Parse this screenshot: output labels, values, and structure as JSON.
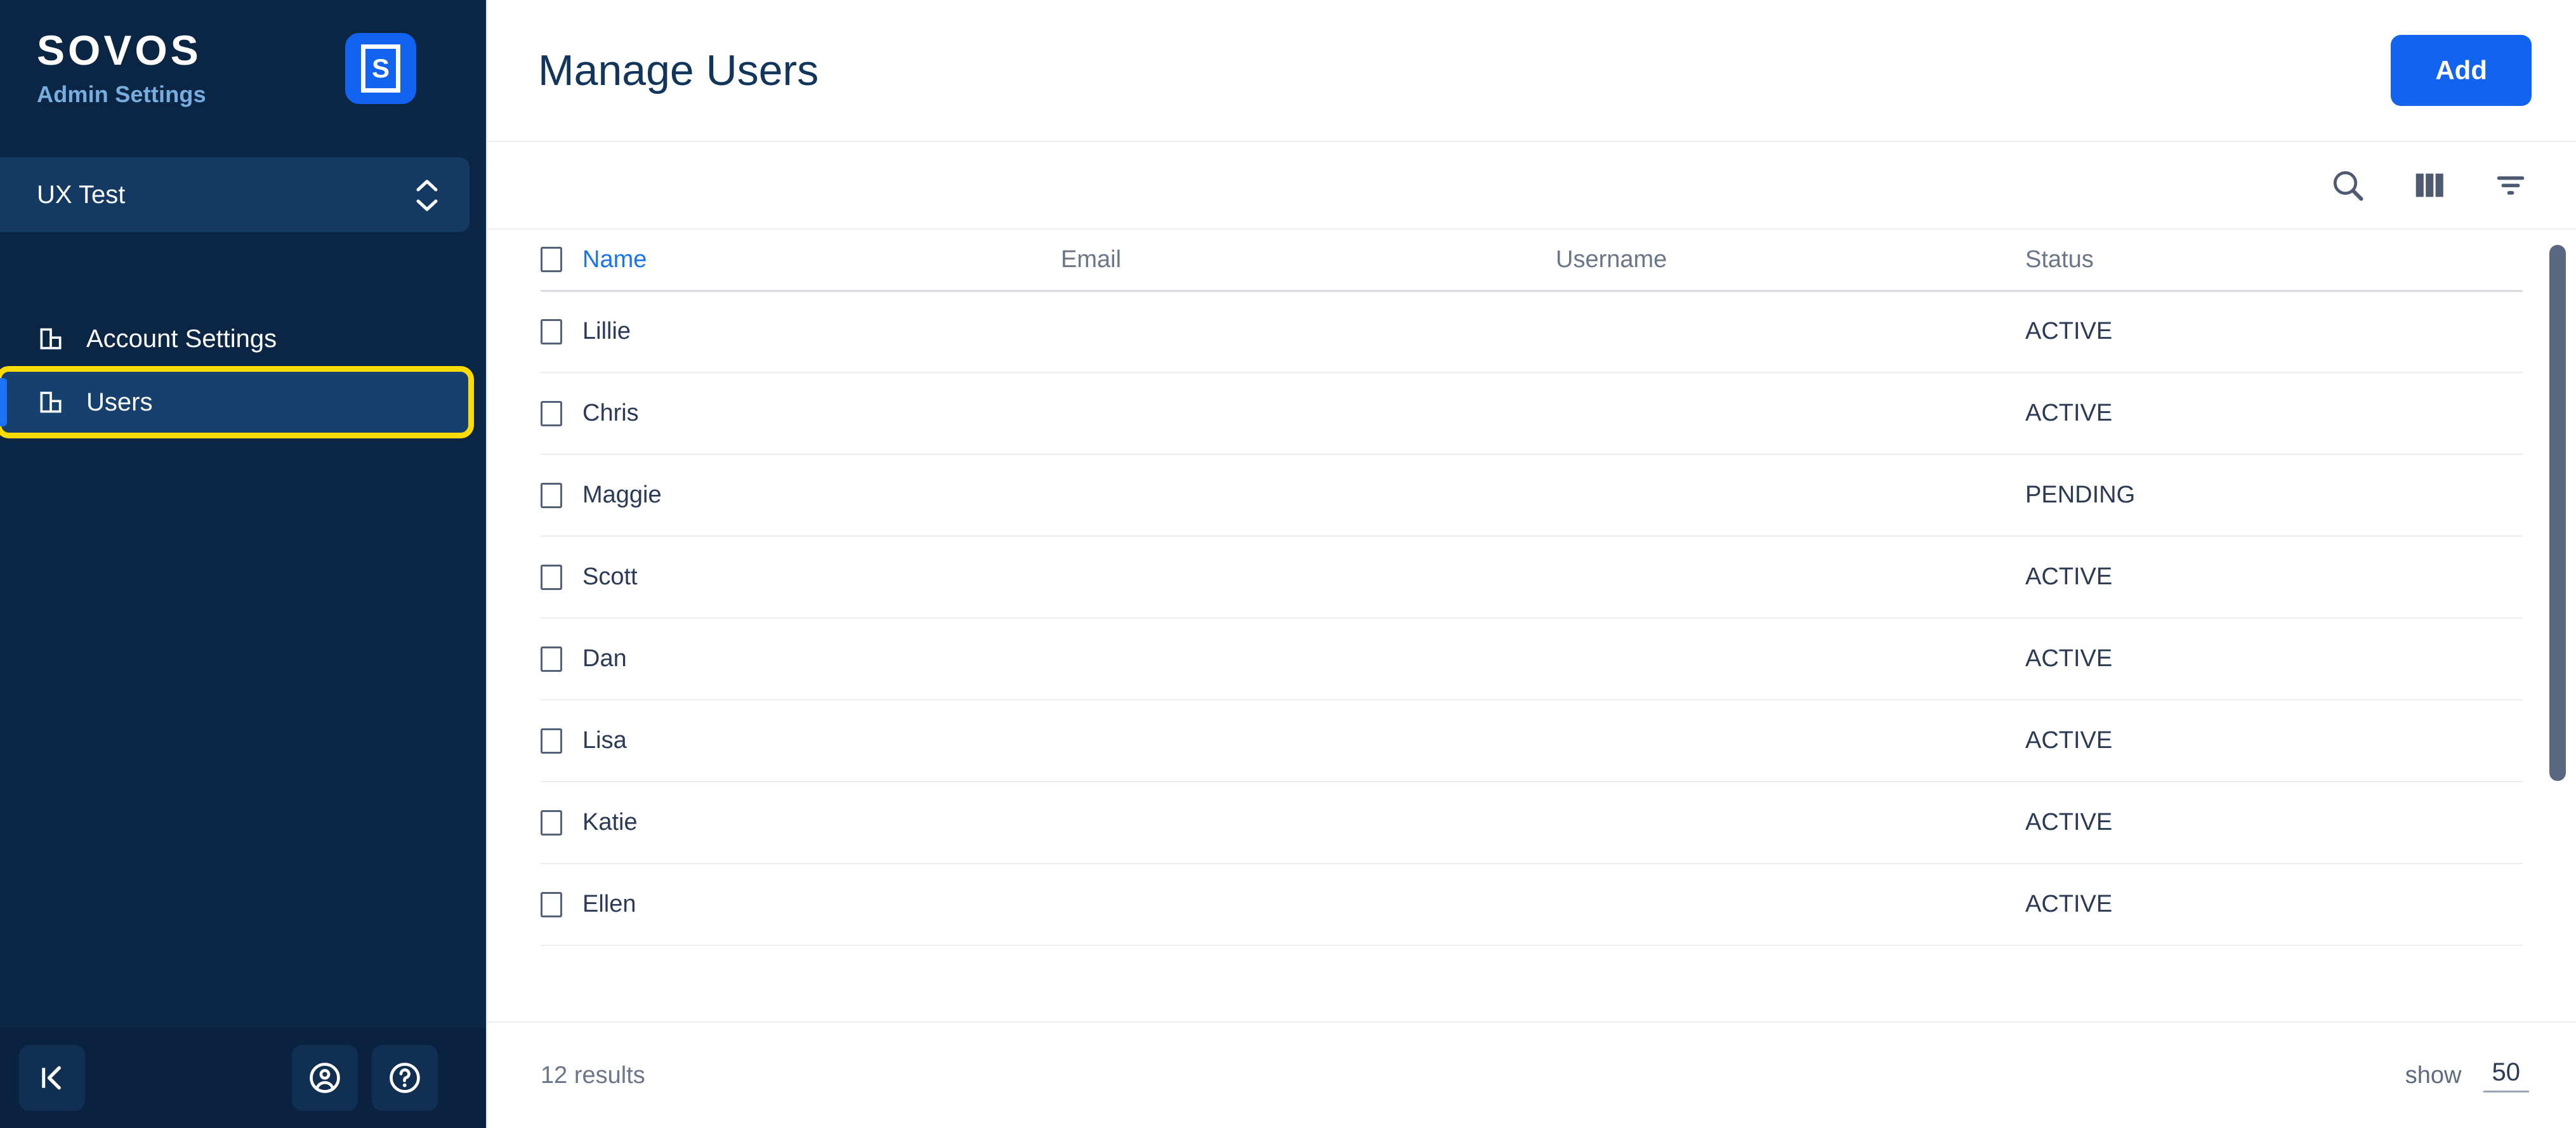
{
  "brand": {
    "name": "SOVOS",
    "subtitle": "Admin Settings",
    "badge_letter": "S"
  },
  "sidebar": {
    "org_selector": {
      "name": "UX Test",
      "chevron_up_icon": "chevron-up-icon",
      "chevron_down_icon": "chevron-down-icon"
    },
    "items": [
      {
        "label": "Account Settings",
        "icon": "building-icon",
        "active": false
      },
      {
        "label": "Users",
        "icon": "building-icon",
        "active": true
      }
    ],
    "footer": {
      "collapse_icon": "collapse-panel-icon",
      "account_icon": "account-circle-icon",
      "help_icon": "help-circle-icon"
    }
  },
  "header": {
    "title": "Manage Users",
    "add_label": "Add"
  },
  "toolbar": {
    "search_icon": "search-icon",
    "columns_icon": "columns-icon",
    "filter_icon": "filter-icon"
  },
  "table": {
    "columns": [
      {
        "key": "name",
        "label": "Name",
        "sorted": true
      },
      {
        "key": "email",
        "label": "Email",
        "sorted": false
      },
      {
        "key": "username",
        "label": "Username",
        "sorted": false
      },
      {
        "key": "status",
        "label": "Status",
        "sorted": false
      }
    ],
    "rows": [
      {
        "name": "Lillie",
        "email": "",
        "username": "",
        "status": "ACTIVE"
      },
      {
        "name": "Chris",
        "email": "",
        "username": "",
        "status": "ACTIVE"
      },
      {
        "name": "Maggie",
        "email": "",
        "username": "",
        "status": "PENDING"
      },
      {
        "name": "Scott",
        "email": "",
        "username": "",
        "status": "ACTIVE"
      },
      {
        "name": "Dan",
        "email": "",
        "username": "",
        "status": "ACTIVE"
      },
      {
        "name": "Lisa",
        "email": "",
        "username": "",
        "status": "ACTIVE"
      },
      {
        "name": "Katie",
        "email": "",
        "username": "",
        "status": "ACTIVE"
      },
      {
        "name": "Ellen",
        "email": "",
        "username": "",
        "status": "ACTIVE"
      }
    ]
  },
  "footer": {
    "results_text": "12 results",
    "show_label": "show",
    "show_value": "50"
  },
  "colors": {
    "sidebar_bg": "#0b2545",
    "sidebar_active": "#16406d",
    "accent_blue": "#1263ef",
    "focus_yellow": "#ffdc00",
    "title_navy": "#12355b",
    "muted_gray": "#6b7689"
  }
}
